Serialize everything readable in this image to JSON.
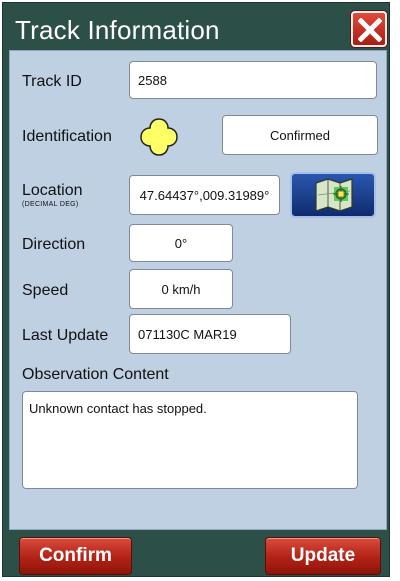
{
  "window": {
    "title": "Track Information"
  },
  "fields": {
    "track_id": {
      "label": "Track ID",
      "value": "2588"
    },
    "identification": {
      "label": "Identification",
      "value": "Confirmed",
      "symbol_color": "#ffff66"
    },
    "location": {
      "label": "Location",
      "sublabel": "(DECIMAL DEG)",
      "value": "47.64437°,009.31989°"
    },
    "direction": {
      "label": "Direction",
      "value": "0°"
    },
    "speed": {
      "label": "Speed",
      "value": "0 km/h"
    },
    "last_update": {
      "label": "Last Update",
      "value": "071130C MAR19"
    },
    "observation": {
      "label": "Observation Content",
      "value": "Unknown contact has stopped."
    }
  },
  "buttons": {
    "confirm": "Confirm",
    "update": "Update"
  },
  "colors": {
    "accent_red": "#b22216",
    "panel": "#bfd0e3",
    "frame": "#2c4f47",
    "map_button": "#1a3f8f"
  },
  "icons": {
    "close": "close-x-icon",
    "map": "map-target-icon",
    "identity": "unknown-contact-symbol-icon"
  }
}
